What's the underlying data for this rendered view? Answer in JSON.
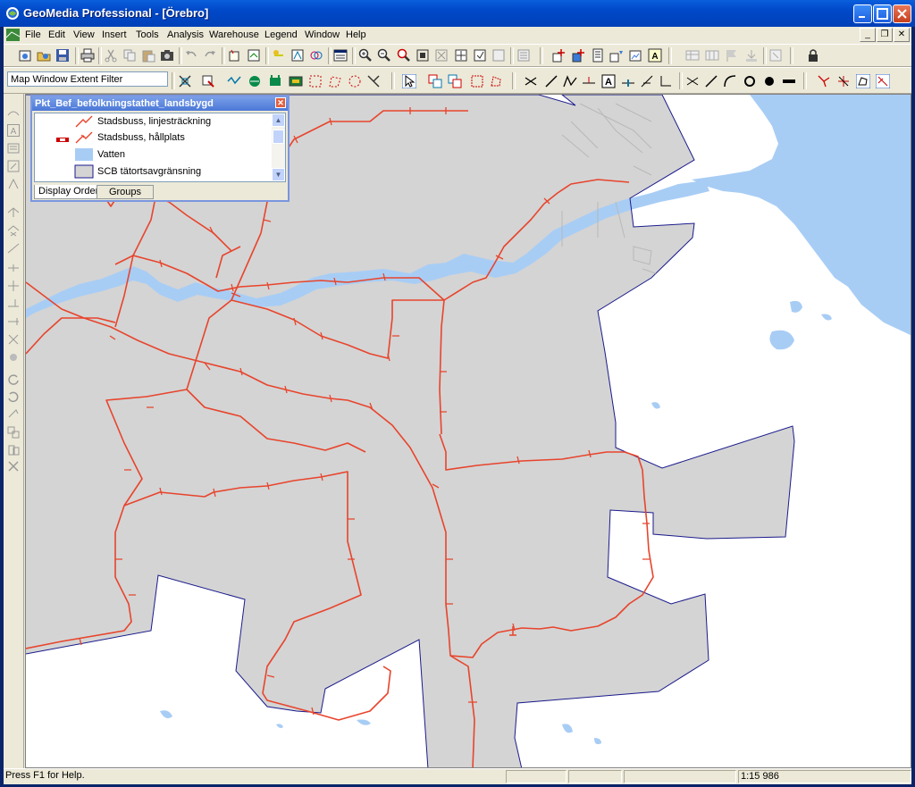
{
  "window": {
    "title": "GeoMedia Professional - [Örebro]"
  },
  "menubar": {
    "items": [
      "File",
      "Edit",
      "View",
      "Insert",
      "Tools",
      "Analysis",
      "Warehouse",
      "Legend",
      "Window",
      "Help"
    ]
  },
  "toolbar2": {
    "filter_text": "Map Window Extent Filter"
  },
  "legend": {
    "title": "Pkt_Bef_befolkningstathet_landsbygd",
    "entries": [
      {
        "label": "Stadsbuss, linjesträckning",
        "symbol": "line",
        "color": "#e8442c"
      },
      {
        "label": "Stadsbuss, hållplats",
        "symbol": "line-with-stop",
        "color": "#e8442c"
      },
      {
        "label": "Vatten",
        "symbol": "area",
        "color": "#a8cdf5"
      },
      {
        "label": "SCB tätortsavgränsning",
        "symbol": "area",
        "color": "#d4d4d4"
      }
    ],
    "tabs": [
      "Display Order",
      "Groups"
    ]
  },
  "statusbar": {
    "help_text": "Press F1 for Help.",
    "scale": "1:15 986"
  },
  "colors": {
    "water": "#a8cdf5",
    "urban_area": "#d4d4d4",
    "urban_border": "#1a1a8c",
    "bus_route": "#e8442c",
    "titlebar": "#0a5fdc"
  }
}
